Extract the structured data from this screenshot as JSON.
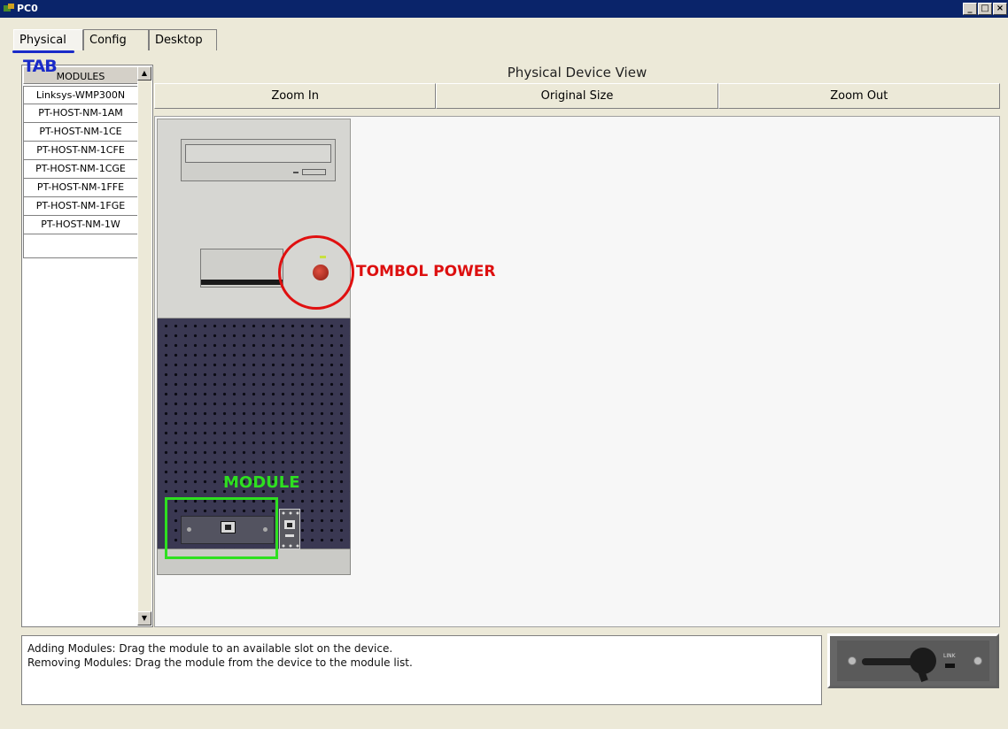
{
  "window": {
    "title": "PC0",
    "controls": [
      "_",
      "□",
      "×"
    ]
  },
  "tabs": [
    {
      "label": "Physical",
      "active": true
    },
    {
      "label": "Config",
      "active": false
    },
    {
      "label": "Desktop",
      "active": false
    }
  ],
  "sidebar": {
    "header": "MODULES",
    "items": [
      "Linksys-WMP300N",
      "PT-HOST-NM-1AM",
      "PT-HOST-NM-1CE",
      "PT-HOST-NM-1CFE",
      "PT-HOST-NM-1CGE",
      "PT-HOST-NM-1FFE",
      "PT-HOST-NM-1FGE",
      "PT-HOST-NM-1W"
    ],
    "scroll_up": "▲",
    "scroll_down": "▼"
  },
  "view": {
    "title": "Physical Device View",
    "zoom_in": "Zoom In",
    "original_size": "Original Size",
    "zoom_out": "Zoom Out"
  },
  "annotations": {
    "tab": "TAB",
    "power": "TOMBOL POWER",
    "module": "MODULE",
    "colors": {
      "tab": "#1a2bc8",
      "power": "#dd1010",
      "module": "#2ee020"
    }
  },
  "info": {
    "line1": "Adding Modules: Drag the module to an available slot on the device.",
    "line2": "Removing Modules: Drag the module from the device to the module list."
  },
  "preview": {
    "link_label": "LINK"
  }
}
